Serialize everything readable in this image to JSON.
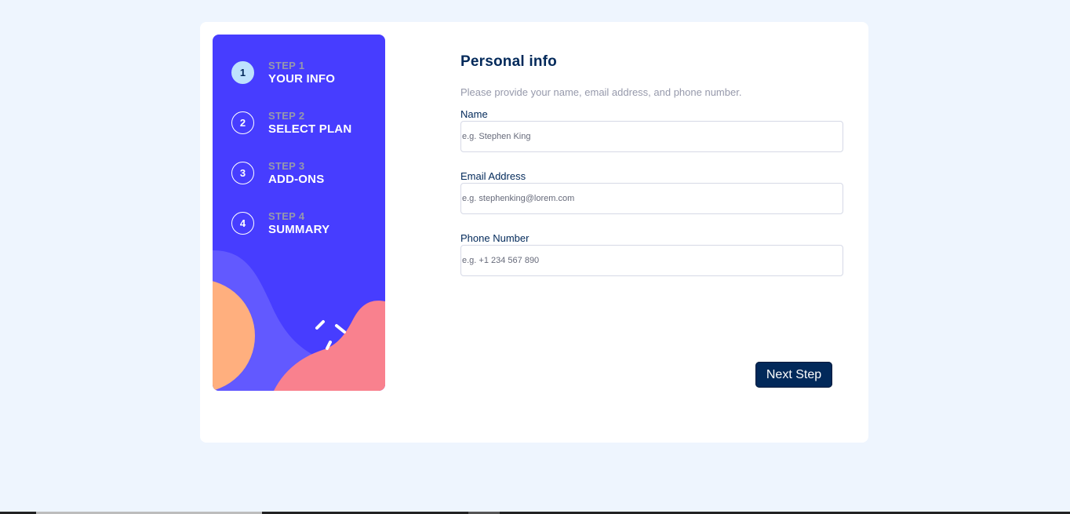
{
  "sidebar": {
    "steps": [
      {
        "number": "1",
        "step_label": "STEP 1",
        "title": "YOUR INFO",
        "active": true
      },
      {
        "number": "2",
        "step_label": "STEP 2",
        "title": "SELECT PLAN",
        "active": false
      },
      {
        "number": "3",
        "step_label": "STEP 3",
        "title": "ADD-ONS",
        "active": false
      },
      {
        "number": "4",
        "step_label": "STEP 4",
        "title": "SUMMARY",
        "active": false
      }
    ]
  },
  "form": {
    "title": "Personal info",
    "subtitle": "Please provide your name, email address, and phone number.",
    "fields": [
      {
        "label": "Name",
        "placeholder": "e.g. Stephen King",
        "value": ""
      },
      {
        "label": "Email Address",
        "placeholder": "e.g. stephenking@lorem.com",
        "value": ""
      },
      {
        "label": "Phone Number",
        "placeholder": "e.g. +1 234 567 890",
        "value": ""
      }
    ],
    "next_button": "Next Step"
  },
  "colors": {
    "background": "#eef5fe",
    "sidebar": "#473dff",
    "active_step": "#bee2fd",
    "primary_text": "#02295a",
    "muted_text": "#9699ab",
    "button": "#02295a",
    "decor_orange": "#ffaf7e",
    "decor_pink": "#f9818e",
    "decor_violet": "#6259ff"
  },
  "icons": {
    "decor_sparkles": "sparkle-lines-icon"
  }
}
